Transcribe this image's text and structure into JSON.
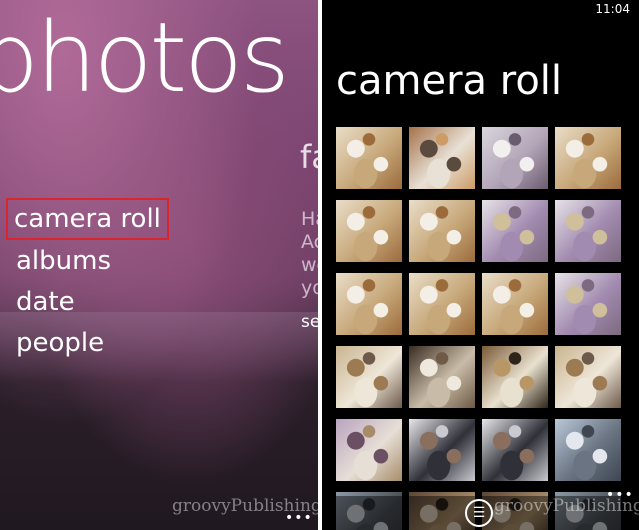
{
  "left_panel": {
    "hub_title": "photos",
    "next_section_title": "fa",
    "next_section_text": [
      "Ha",
      "Ac",
      "we",
      "yo"
    ],
    "next_section_link": "se",
    "menu": [
      {
        "label": "camera roll",
        "selected": true
      },
      {
        "label": "albums",
        "selected": false
      },
      {
        "label": "date",
        "selected": false
      },
      {
        "label": "people",
        "selected": false
      }
    ],
    "watermark": "groovyPublishing",
    "more_dots": "•••"
  },
  "right_panel": {
    "status_time": "11:04",
    "page_title": "camera roll",
    "watermark": "groovyPublishing",
    "more_dots": "•••",
    "list_icon_glyph": "☰",
    "thumbnails": [
      "food-table-overhead",
      "kitchen-people",
      "person-seated-table",
      "food-table-overhead",
      "food-table-overhead",
      "food-table-overhead",
      "person-at-table",
      "person-at-table",
      "food-table-overhead",
      "food-table-overhead",
      "food-table-overhead",
      "person-at-table",
      "people-at-table",
      "glass-display",
      "kitchen-corner",
      "people-at-table",
      "people-room",
      "people-standing",
      "people-standing",
      "parking-lot",
      "outdoor",
      "room",
      "room",
      "outdoor"
    ]
  }
}
